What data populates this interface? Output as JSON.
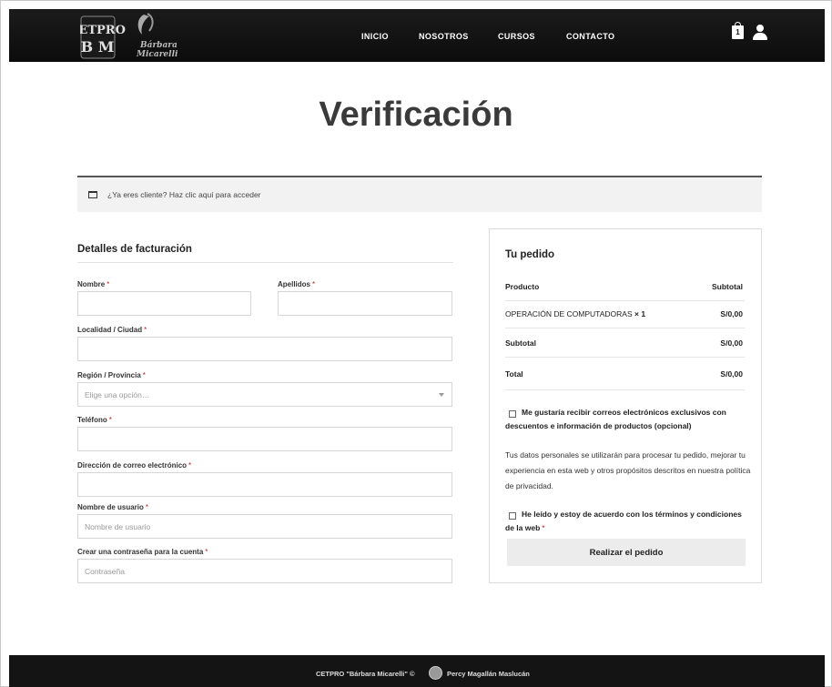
{
  "header": {
    "logo_text": "CETPRO BM Bárbara Micarelli",
    "nav": [
      {
        "label": "INICIO"
      },
      {
        "label": "NOSOTROS"
      },
      {
        "label": "CURSOS"
      },
      {
        "label": "CONTACTO"
      }
    ],
    "cart_count": "1",
    "icons": {
      "cart": "shopping-bag-icon",
      "account": "user-icon"
    }
  },
  "page": {
    "title": "Verificación"
  },
  "notice": {
    "text": "¿Ya eres cliente? Haz clic aquí para acceder",
    "icon": "window-icon"
  },
  "billing": {
    "title": "Detalles de facturación",
    "required_mark": "*",
    "fields": {
      "first_name": {
        "label": "Nombre",
        "value": "",
        "placeholder": ""
      },
      "last_name": {
        "label": "Apellidos",
        "value": "",
        "placeholder": ""
      },
      "city": {
        "label": "Localidad / Ciudad",
        "value": "",
        "placeholder": ""
      },
      "region": {
        "label": "Región / Provincia",
        "selected": "Elige una opción…"
      },
      "phone": {
        "label": "Teléfono",
        "value": "",
        "placeholder": ""
      },
      "email": {
        "label": "Dirección de correo electrónico",
        "value": "",
        "placeholder": ""
      },
      "username": {
        "label": "Nombre de usuario",
        "value": "",
        "placeholder": "Nombre de usuario"
      },
      "password": {
        "label": "Crear una contraseña para la cuenta",
        "value": "",
        "placeholder": "Contraseña"
      }
    }
  },
  "order": {
    "title": "Tu pedido",
    "col_product": "Producto",
    "col_subtotal": "Subtotal",
    "item_name": "OPERACIÓN DE COMPUTADORAS",
    "item_qty": "× 1",
    "item_price": "S/0,00",
    "subtotal_label": "Subtotal",
    "subtotal_value": "S/0,00",
    "total_label": "Total",
    "total_value": "S/0,00",
    "marketing_opt_in": "Me gustaría recibir correos electrónicos exclusivos con descuentos e información de productos (opcional)",
    "privacy_text": "Tus datos personales se utilizarán para procesar tu pedido, mejorar tu experiencia en esta web y otros propósitos descritos en nuestra política de privacidad.",
    "terms_text": "He leído y estoy de acuerdo con los términos y condiciones de la web",
    "terms_required": "*",
    "place_order_label": "Realizar el pedido"
  },
  "footer": {
    "copyright": "CETPRO \"Bárbara Micarelli\" ©",
    "author": "Percy Magallán Maslucán"
  }
}
